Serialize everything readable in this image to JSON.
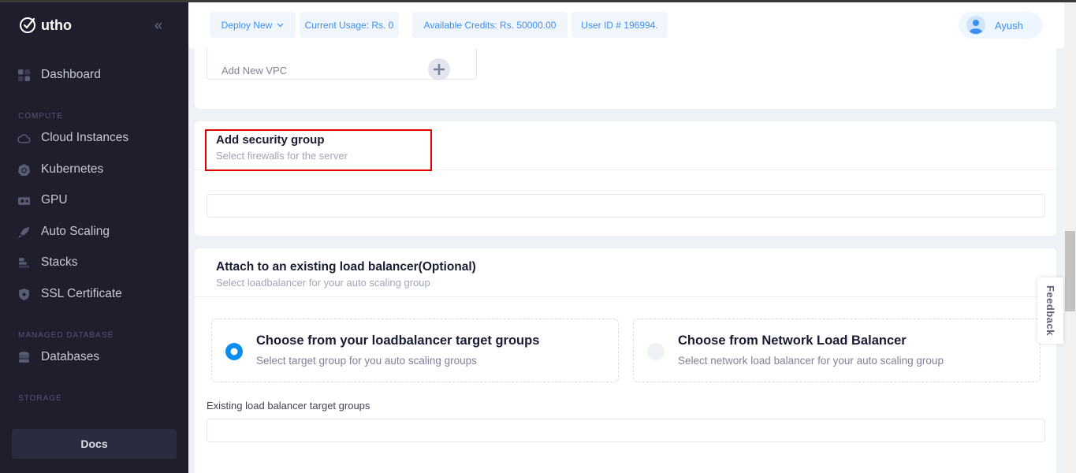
{
  "sidebar": {
    "brand": "utho",
    "items": [
      {
        "label": "Dashboard",
        "icon": "dashboard-icon"
      },
      {
        "label": "Cloud Instances",
        "icon": "cloud-icon"
      },
      {
        "label": "Kubernetes",
        "icon": "kubernetes-icon"
      },
      {
        "label": "GPU",
        "icon": "gpu-icon"
      },
      {
        "label": "Auto Scaling",
        "icon": "rocket-icon"
      },
      {
        "label": "Stacks",
        "icon": "stacks-icon"
      },
      {
        "label": "SSL Certificate",
        "icon": "shield-icon"
      },
      {
        "label": "Databases",
        "icon": "database-icon"
      }
    ],
    "sections": [
      "COMPUTE",
      "MANAGED DATABASE",
      "STORAGE"
    ],
    "docs": "Docs"
  },
  "header": {
    "deploy": "Deploy New",
    "usage": "Current Usage: Rs. 0",
    "credits": "Available Credits: Rs. 50000.00",
    "user_id": "User ID # 196994.",
    "user_name": "Ayush"
  },
  "vpc": {
    "add_label": "Add New VPC"
  },
  "security_group": {
    "title": "Add security group",
    "subtitle": "Select firewalls for the server"
  },
  "load_balancer": {
    "title": "Attach to an existing load balancer(Optional)",
    "subtitle": "Select loadbalancer for your auto scaling group",
    "options": [
      {
        "title": "Choose from your loadbalancer target groups",
        "subtitle": "Select target group for you auto scaling groups",
        "selected": true
      },
      {
        "title": "Choose from Network Load Balancer",
        "subtitle": "Select network load balancer for your auto scaling group",
        "selected": false
      }
    ],
    "field_label": "Existing load balancer target groups"
  },
  "feedback": "Feedback",
  "colors": {
    "accent": "#3d8ef0",
    "sidebar": "#1e1e2d",
    "highlight": "#e00000"
  }
}
